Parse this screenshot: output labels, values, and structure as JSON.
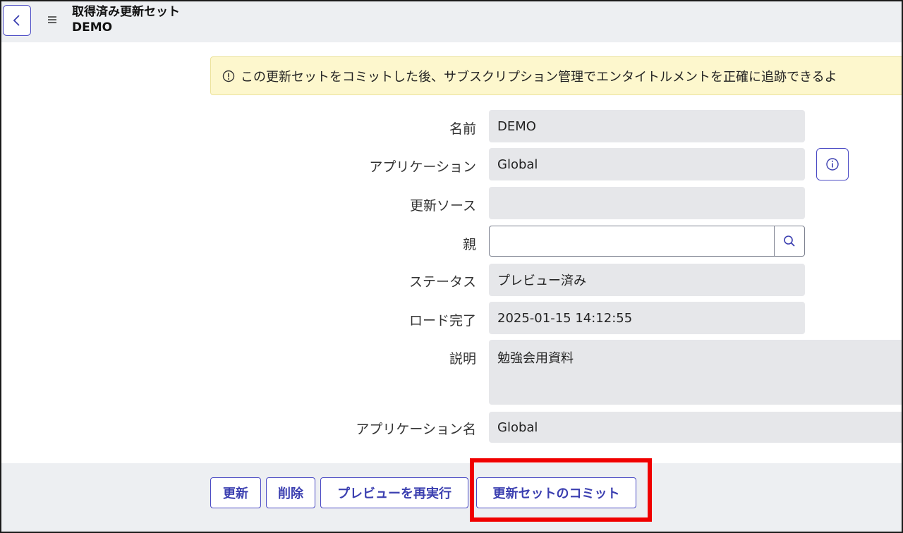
{
  "header": {
    "back_icon": "chevron-left-icon",
    "menu_icon": "hamburger-menu-icon",
    "title": "取得済み更新セット",
    "subtitle": "DEMO"
  },
  "notice": {
    "icon": "info-circle-icon",
    "text": "この更新セットをコミットした後、サブスクリプション管理でエンタイトルメントを正確に追跡できるよ"
  },
  "form": {
    "name_label": "名前",
    "name_value": "DEMO",
    "application_label": "アプリケーション",
    "application_value": "Global",
    "update_source_label": "更新ソース",
    "update_source_value": "",
    "parent_label": "親",
    "parent_value": "",
    "status_label": "ステータス",
    "status_value": "プレビュー済み",
    "load_completed_label": "ロード完了",
    "load_completed_value": "2025-01-15 14:12:55",
    "description_label": "説明",
    "description_value": "勉強会用資料",
    "application_name_label": "アプリケーション名",
    "application_name_value": "Global"
  },
  "buttons": {
    "update": "更新",
    "delete": "削除",
    "rerun_preview": "プレビューを再実行",
    "commit": "更新セットのコミット"
  },
  "colors": {
    "accent": "#4a4ac4",
    "highlight": "#f00000",
    "notice_bg": "#fdf7cd",
    "field_bg": "#e6e7ea"
  }
}
